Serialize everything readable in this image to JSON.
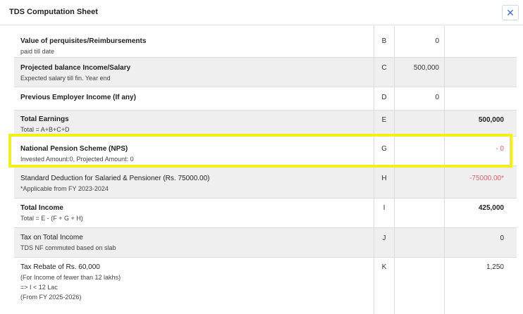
{
  "header": {
    "title": "TDS Computation Sheet",
    "close_label": "✕"
  },
  "rows": [
    {
      "label": "Value of perquisites/Reimbursements",
      "sub": "paid till date",
      "code": "B",
      "val1": "0",
      "val2": ""
    },
    {
      "label": "Projected balance Income/Salary",
      "sub": "Expected salary till fin. Year end",
      "code": "C",
      "val1": "500,000",
      "val2": ""
    },
    {
      "label": "Previous Employer Income (If any)",
      "sub": "",
      "code": "D",
      "val1": "0",
      "val2": ""
    },
    {
      "label": "Total Earnings",
      "sub": "Total = A+B+C+D",
      "code": "E",
      "val1": "",
      "val2": "500,000"
    },
    {
      "label": "National Pension Scheme (NPS)",
      "sub": "Invested Amount:0, Projected Amount: 0",
      "code": "G",
      "val1": "",
      "val2": "- 0"
    },
    {
      "label": "Standard Deduction for Salaried & Pensioner (Rs. 75000.00)",
      "sub": "*Applicable from FY 2023-2024",
      "code": "H",
      "val1": "",
      "val2": "-75000.00*"
    },
    {
      "label": "Total Income",
      "sub": "Total = E - (F + G + H)",
      "code": "I",
      "val1": "",
      "val2": "425,000"
    },
    {
      "label": "Tax on Total Income",
      "sub": "TDS NF commuted based on slab",
      "code": "J",
      "val1": "",
      "val2": "0"
    },
    {
      "label": "Tax Rebate of Rs. 60,000",
      "sub1": "(For Income of fewer than 12 lakhs)",
      "sub2": "=> I < 12 Lac",
      "sub3": "(From FY 2025-2026)",
      "code": "K",
      "val1": "",
      "val2": "1,250"
    }
  ],
  "colors": {
    "highlight": "#f2ef1a",
    "negative": "#e0646a",
    "close_icon": "#3a6fd8"
  }
}
